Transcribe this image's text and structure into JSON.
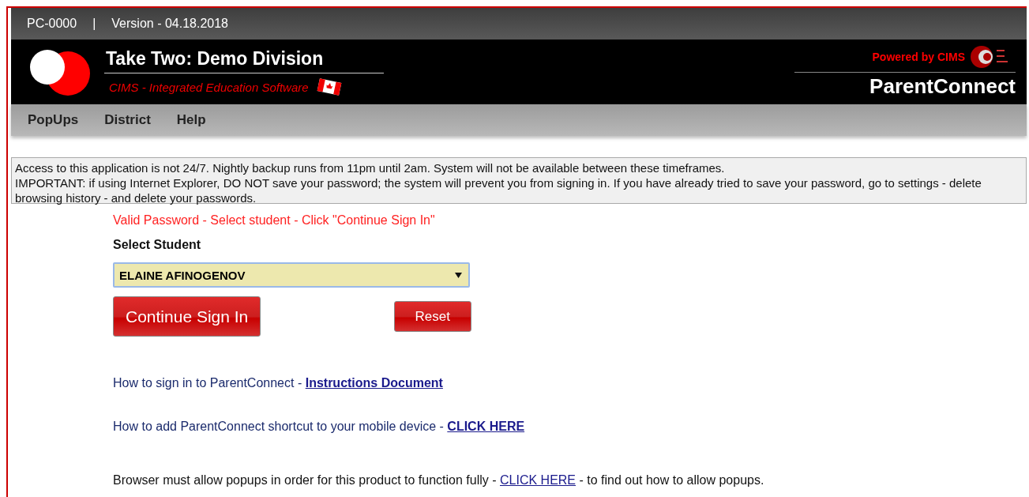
{
  "top_bar": {
    "code": "PC-0000",
    "separator": "|",
    "version": "Version - 04.18.2018"
  },
  "header": {
    "title": "Take Two: Demo Division",
    "subtitle": "CIMS - Integrated Education Software",
    "powered_by": "Powered by CIMS",
    "product": "ParentConnect"
  },
  "menu": [
    {
      "label": "PopUps"
    },
    {
      "label": "District"
    },
    {
      "label": "Help"
    }
  ],
  "notice": "Access to this application is not 24/7. Nightly backup runs from 11pm until 2am. System will not be available between these timeframes.\nIMPORTANT: if using Internet Explorer, DO NOT save your password; the system will prevent you from signing in. If you have already tried to save your password, go to settings - delete browsing history - and delete your passwords.",
  "status_message": "Valid Password - Select student - Click \"Continue Sign In\"",
  "student_select": {
    "label": "Select Student",
    "value": "ELAINE AFINOGENOV"
  },
  "buttons": {
    "continue": "Continue Sign In",
    "reset": "Reset"
  },
  "help_lines": [
    {
      "kind": "blue",
      "text": "How to sign in to ParentConnect - ",
      "link": "Instructions Document"
    },
    {
      "kind": "blue",
      "text": "How to add ParentConnect shortcut to your mobile device - ",
      "link": "CLICK HERE"
    },
    {
      "kind": "plain",
      "text": "Browser must allow popups in order for this product to function fully - ",
      "link": "CLICK HERE",
      "after": " - to find out how to allow popups."
    }
  ]
}
